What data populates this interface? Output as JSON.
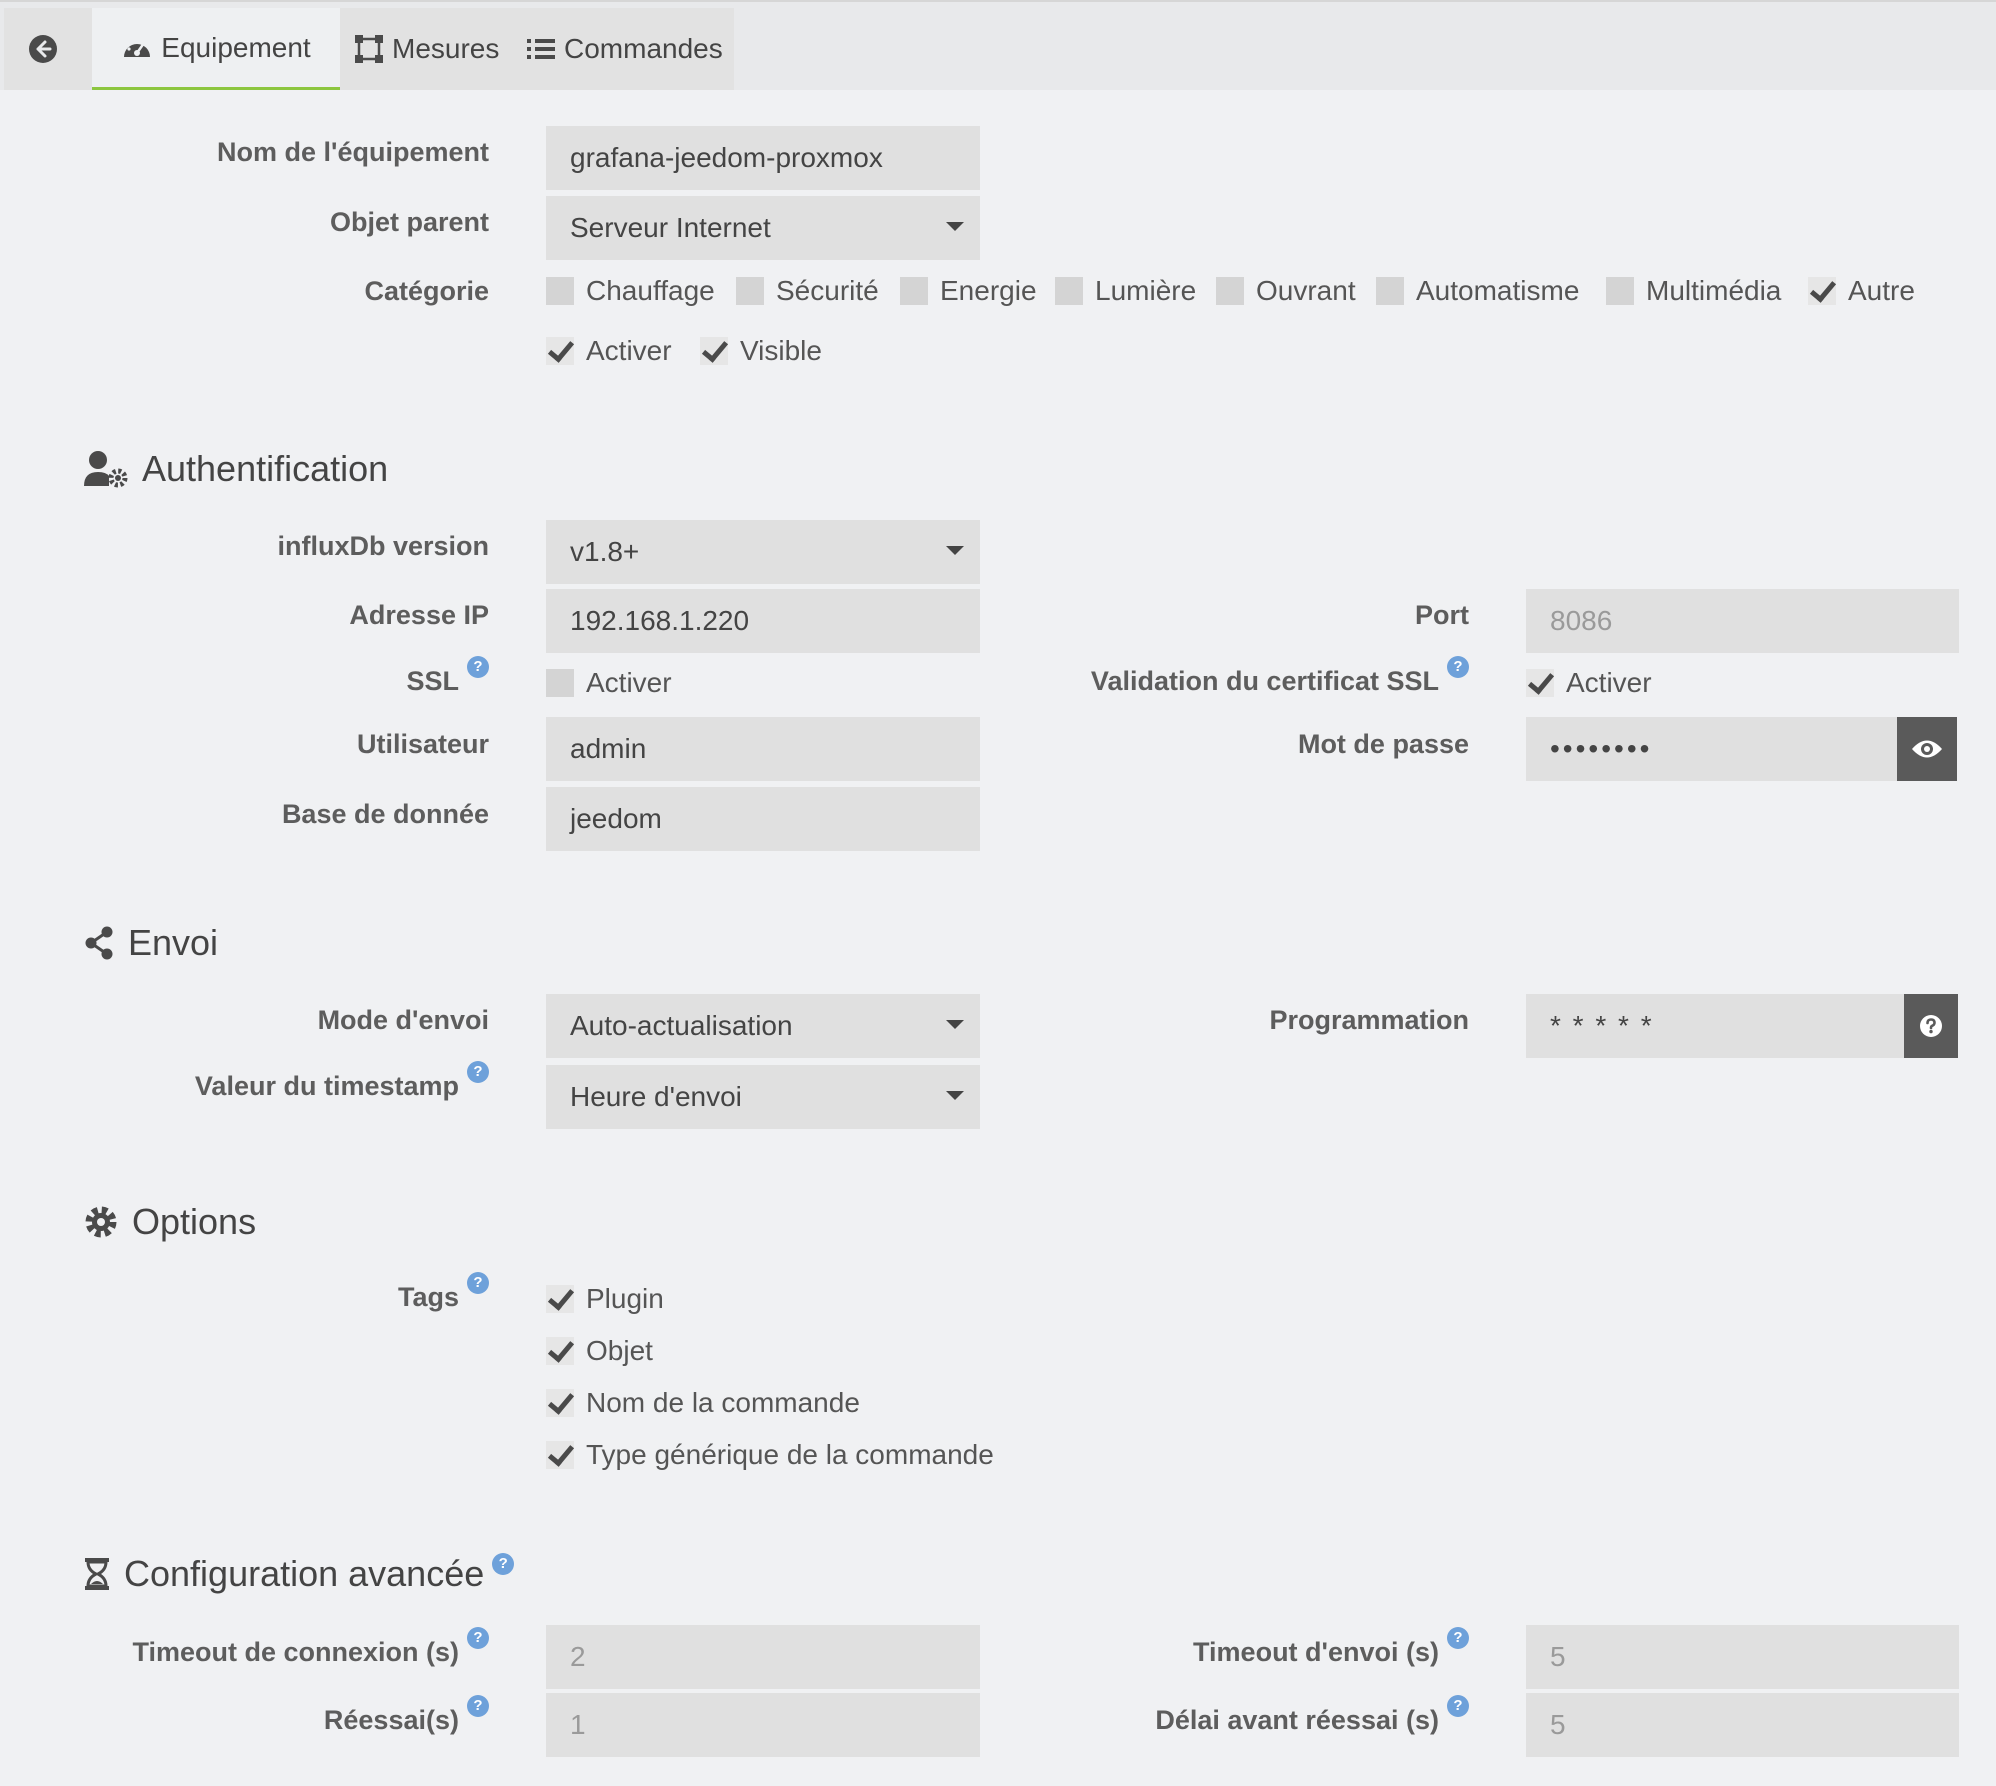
{
  "tabs": {
    "back": "back",
    "equipement": "Equipement",
    "mesures": "Mesures",
    "commandes": "Commandes"
  },
  "general": {
    "name_label": "Nom de l'équipement",
    "name_value": "grafana-jeedom-proxmox",
    "parent_label": "Objet parent",
    "parent_value": "Serveur Internet",
    "category_label": "Catégorie",
    "categories": [
      {
        "label": "Chauffage",
        "checked": false
      },
      {
        "label": "Sécurité",
        "checked": false
      },
      {
        "label": "Energie",
        "checked": false
      },
      {
        "label": "Lumière",
        "checked": false
      },
      {
        "label": "Ouvrant",
        "checked": false
      },
      {
        "label": "Automatisme",
        "checked": false
      },
      {
        "label": "Multimédia",
        "checked": false
      },
      {
        "label": "Autre",
        "checked": true
      }
    ],
    "activer_label": "Activer",
    "visible_label": "Visible"
  },
  "auth": {
    "title": "Authentification",
    "influx_label": "influxDb version",
    "influx_value": "v1.8+",
    "ip_label": "Adresse IP",
    "ip_value": "192.168.1.220",
    "port_label": "Port",
    "port_value": "8086",
    "ssl_label": "SSL",
    "ssl_activer": "Activer",
    "sslcert_label": "Validation du certificat SSL",
    "sslcert_activer": "Activer",
    "user_label": "Utilisateur",
    "user_value": "admin",
    "password_label": "Mot de passe",
    "password_value": "••••••••",
    "db_label": "Base de donnée",
    "db_value": "jeedom"
  },
  "envoi": {
    "title": "Envoi",
    "mode_label": "Mode d'envoi",
    "mode_value": "Auto-actualisation",
    "prog_label": "Programmation",
    "prog_value": "* * * * *",
    "timestamp_label": "Valeur du timestamp",
    "timestamp_value": "Heure d'envoi"
  },
  "options": {
    "title": "Options",
    "tags_label": "Tags",
    "tags": [
      "Plugin",
      "Objet",
      "Nom de la commande",
      "Type générique de la commande"
    ]
  },
  "advanced": {
    "title": "Configuration avancée",
    "timeout_conn_label": "Timeout de connexion (s)",
    "timeout_conn_value": "2",
    "timeout_send_label": "Timeout d'envoi (s)",
    "timeout_send_value": "5",
    "retry_label": "Réessai(s)",
    "retry_value": "1",
    "delay_label": "Délai avant réessai (s)",
    "delay_value": "5"
  },
  "help_glyph": "?",
  "colors": {
    "accent": "#8cc63f",
    "help": "#6ea1da",
    "addon": "#5a5a5a"
  }
}
